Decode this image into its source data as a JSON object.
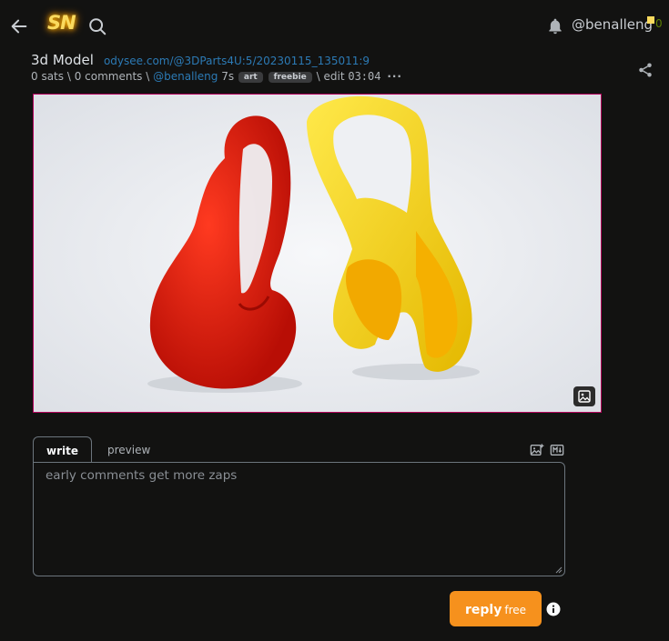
{
  "header": {
    "logo": "SN",
    "username": "@benalleng",
    "sats": "0",
    "accent": "#fada5e"
  },
  "icons": {
    "back": "arrow-left-icon",
    "search": "search-icon",
    "bell": "bell-icon",
    "share": "share-icon",
    "image": "image-icon",
    "image_upload": "image-upload-icon",
    "markdown": "markdown-icon",
    "info": "info-icon"
  },
  "post": {
    "title": "3d Model",
    "url": "odysee.com/@3DParts4U:5/20230115_135011:9",
    "sats": "0 sats",
    "sep1": "\\",
    "comments": "0 comments",
    "sep2": "\\",
    "author": "@benalleng",
    "age": "7s",
    "tags": [
      "art",
      "freebie"
    ],
    "sep3": "\\",
    "edit_label": "edit",
    "edit_timer": "03:04",
    "more": "···"
  },
  "media": {
    "border_color": "#b3005b"
  },
  "comment": {
    "tab_write": "write",
    "tab_preview": "preview",
    "placeholder": "early comments get more zaps",
    "reply_label": "reply",
    "reply_cost": "free",
    "reply_color": "#f6911d"
  }
}
